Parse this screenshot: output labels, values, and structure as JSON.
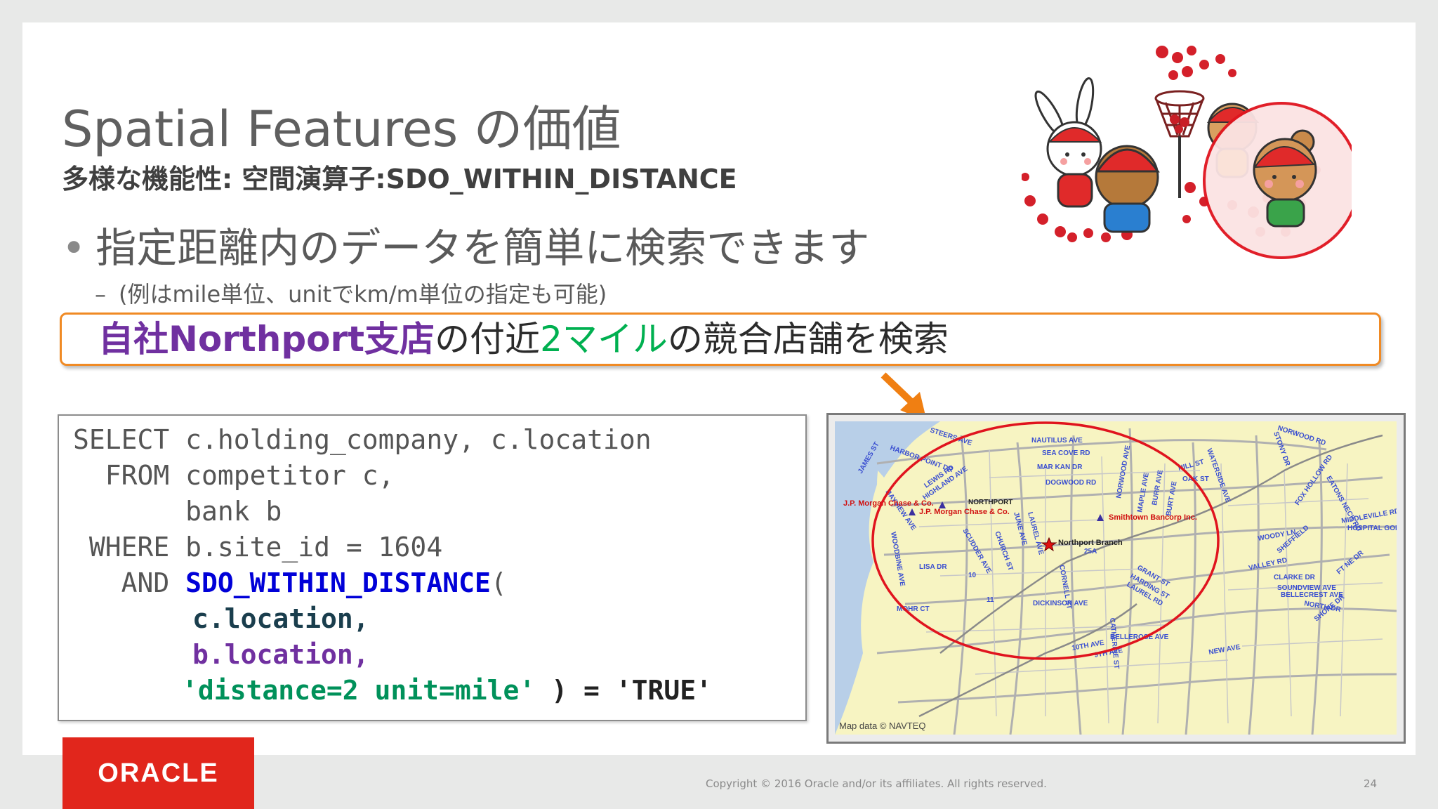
{
  "slide": {
    "title": "Spatial Features の価値",
    "subtitle": "多様な機能性: 空間演算子:SDO_WITHIN_DISTANCE",
    "bullet": "指定距離内のデータを簡単に検索できます",
    "subbullet": "(例はmile単位、unitでkm/m単位の指定も可能)",
    "highlight": {
      "part1": "自社Northport支店",
      "part2": "の付近",
      "part3": "2マイル",
      "part4": "の競合店舗を検索"
    }
  },
  "code": {
    "l1": "SELECT c.holding_company, c.location",
    "l2": "  FROM competitor c,",
    "l3": "       bank b",
    "l4": " WHERE b.site_id = 1604",
    "l5_and": "   AND ",
    "l5_fn": "SDO_WITHIN_DISTANCE",
    "l5_paren": "(",
    "l6": "c.location,",
    "l7": "b.location,",
    "l8_str": "'distance=2 unit=mile'",
    "l8_rest": " ) = 'TRUE'"
  },
  "map": {
    "labels": {
      "jp1": "J.P. Morgan Chase & Co.",
      "jp2": "J.P. Morgan Chase & Co.",
      "smithtown": "Smithtown Bancorp Inc.",
      "branch": "Northport Branch",
      "northport": "NORTHPORT",
      "credit": "Map data © NAVTEQ"
    },
    "streets": [
      "STEERS AVE",
      "NAUTILUS AVE",
      "HARBOR POINT DR",
      "SEA COVE RD",
      "MAR KAN DR",
      "DOGWOOD RD",
      "JAMES ST",
      "BAYVIEW AVE",
      "LEWIS RD",
      "HIGHLAND AVE",
      "NORWOOD AVE",
      "MAPLE AVE",
      "BURR AVE",
      "BURT AVE",
      "HILL ST",
      "OAK ST",
      "WATERSIDE AVE",
      "NORWOOD RD",
      "STONY DR",
      "FOX HOLLOW RD",
      "EATONS NECK RD",
      "MIDDLEVILLE RD",
      "HOSPITAL GOLF",
      "WOODBINE AVE",
      "SCUDDER AVE",
      "CHURCH ST",
      "LAUREL AVE",
      "JUNE AVE",
      "WOODY LN",
      "SHEFFIELD",
      "LISA DR",
      "VALLEY RD",
      "GRANT ST",
      "HARDING ST",
      "LAUREL RD",
      "CLARKE DR",
      "SOUNDVIEW AVE",
      "BELLECREST AVE",
      "NORTH DR",
      "SHORE DR",
      "CORNELL ST",
      "DICKINSON AVE",
      "MOHR CT",
      "CATHERINE ST",
      "BELLEROSE AVE",
      "10TH AVE",
      "9TH AVE",
      "NEW AVE",
      "FT NE DR",
      "25A",
      "10",
      "11"
    ]
  },
  "footer": {
    "logo": "ORACLE",
    "copyright": "Copyright © 2016 Oracle and/or its affiliates. All rights reserved.",
    "page": "24"
  },
  "colors": {
    "orange": "#f08a24",
    "purple": "#7030a0",
    "green": "#00b050",
    "oracle_red": "#e1261c",
    "circle_red": "#e0141e"
  }
}
